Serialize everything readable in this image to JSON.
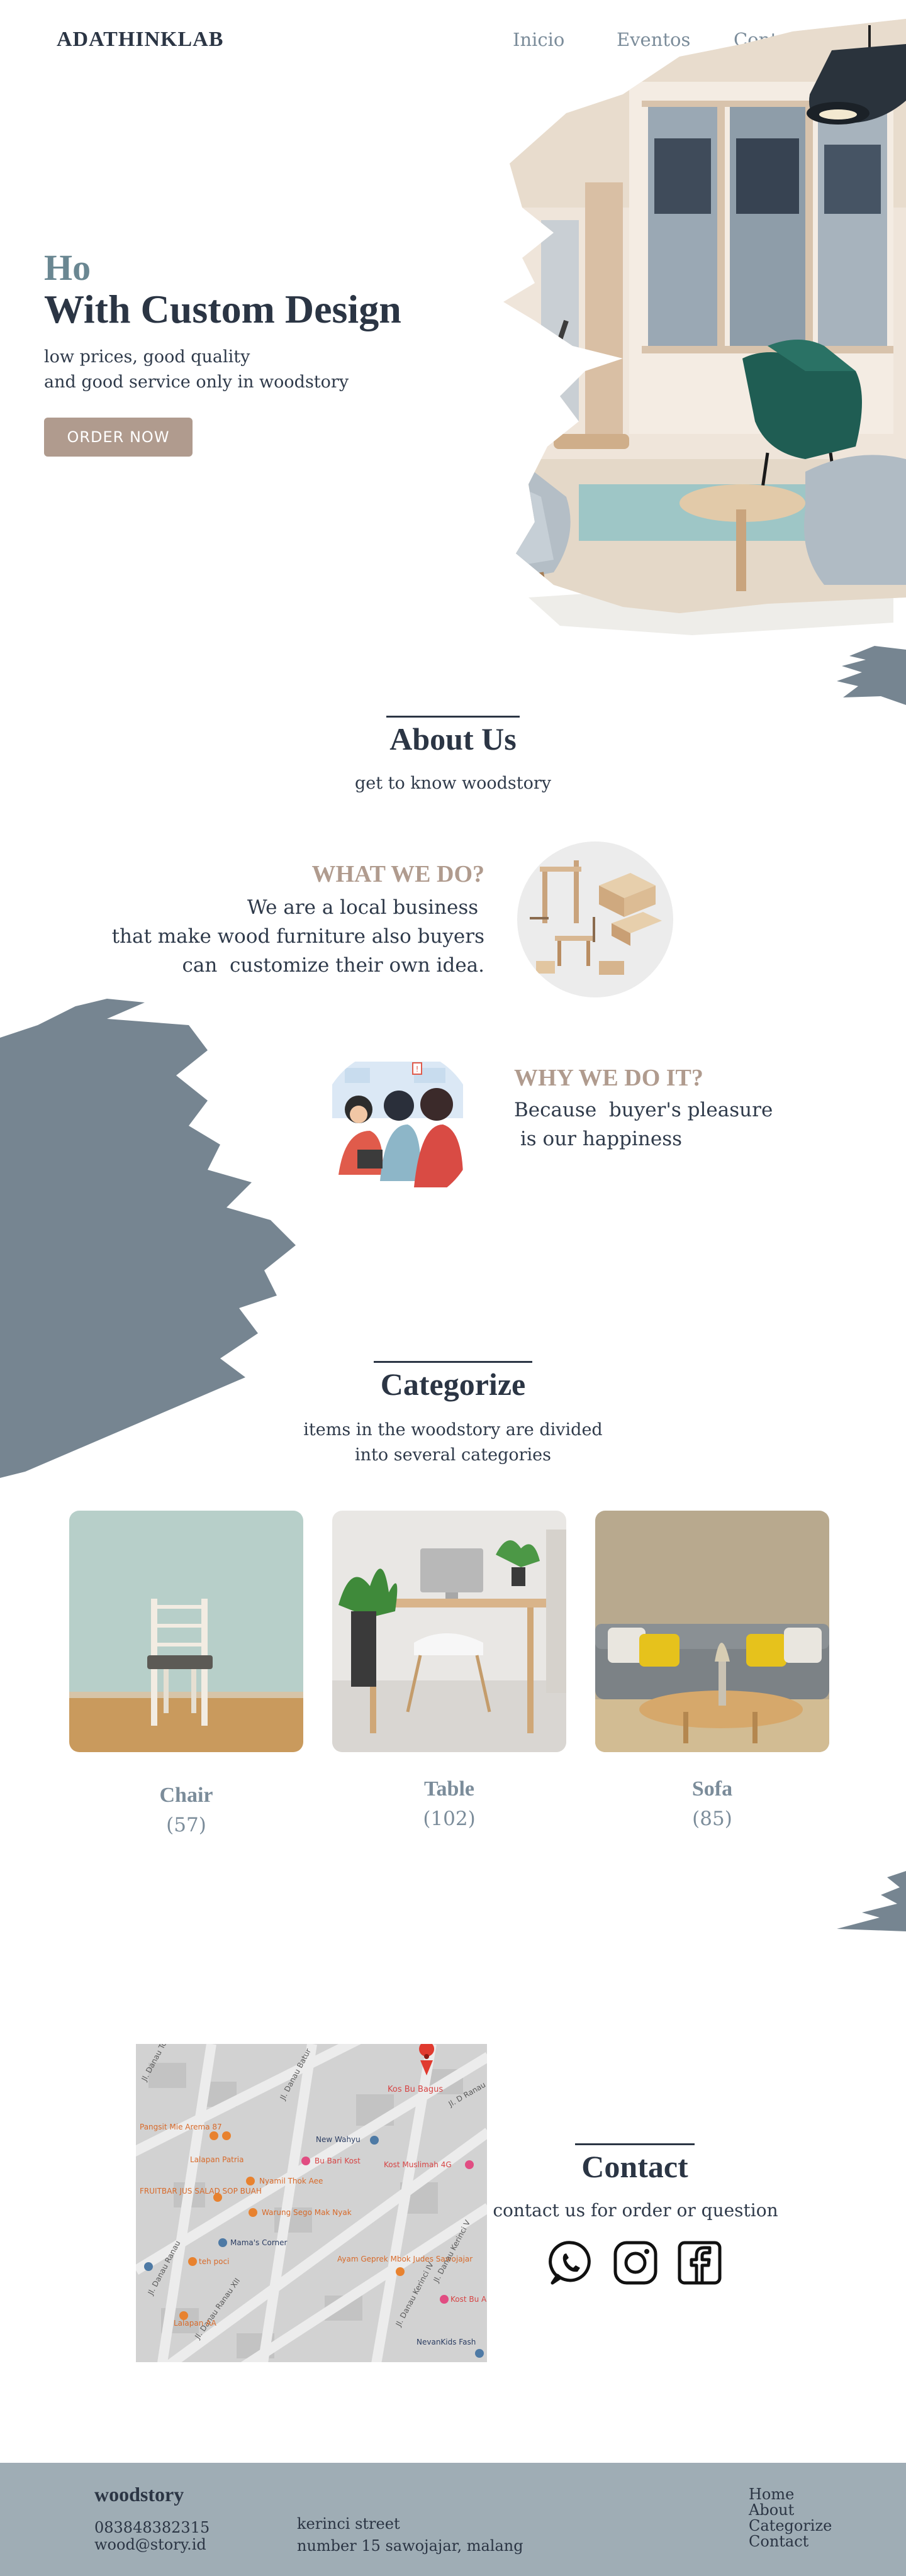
{
  "brand": "ADATHINKLAB",
  "nav": {
    "items": [
      "Inicio",
      "Eventos",
      "Contactos"
    ]
  },
  "hero": {
    "kicker": "Ho",
    "title": "With Custom Design",
    "subtitle_line1": "low prices, good quality",
    "subtitle_line2": "and good service only in woodstory",
    "button": "ORDER NOW"
  },
  "about": {
    "title": "About Us",
    "subtitle": "get to know woodstory",
    "what": {
      "heading": "WHAT WE DO?",
      "text": "We are a local business \nthat make wood furniture also buyers\ncan  customize their own idea."
    },
    "why": {
      "heading": "WHY WE DO IT?",
      "text": "Because  buyer's pleasure\n is our happiness"
    }
  },
  "categorize": {
    "title": "Categorize",
    "subtitle_line1": "items in the woodstory are divided",
    "subtitle_line2": "into several categories",
    "items": [
      {
        "name": "Chair",
        "count": "(57)"
      },
      {
        "name": "Table",
        "count": "(102)"
      },
      {
        "name": "Sofa",
        "count": "(85)"
      }
    ]
  },
  "map": {
    "labels": [
      "Kos Bu Bagus",
      "Jl. Danau Toba",
      "Jl. Danau Batur",
      "Jl. D Ranau",
      "Pangsit Mie Arema 87",
      "New Wahyu",
      "Lalapan Patria",
      "Bu Bari Kost",
      "Kost Muslimah 4G",
      "Nyamil Thok Aee",
      "FRUITBAR JUS SALAD SOP BUAH",
      "Warung Sego Mak Nyak",
      "Mama's Corner",
      "teh poci",
      "Ayam Geprek Mbok Judes Sawojajar",
      "Jl. Danau Kerinci V",
      "Jl. Danau Ranau XII",
      "Lalapan AA",
      "Kost Bu Ai",
      "NevanKids Fash",
      "Jl. Danau Kerinci IV",
      "Jl. Danau Ranau"
    ]
  },
  "contact": {
    "title": "Contact",
    "subtitle": "contact us for order or question",
    "icons": [
      "whatsapp-icon",
      "instagram-icon",
      "facebook-icon"
    ]
  },
  "footer": {
    "brand": "woodstory",
    "phone": "083848382315",
    "email": "wood@story.id",
    "address1": "kerinci street",
    "address2": "number 15 sawojajar, malang",
    "links": [
      "Home",
      "About",
      "Categorize",
      "Contact"
    ]
  },
  "colors": {
    "dark": "#2b3544",
    "slate": "#7b8c9a",
    "brush": "#768591",
    "accent": "#b09b8e",
    "footer": "#9fadb5"
  }
}
